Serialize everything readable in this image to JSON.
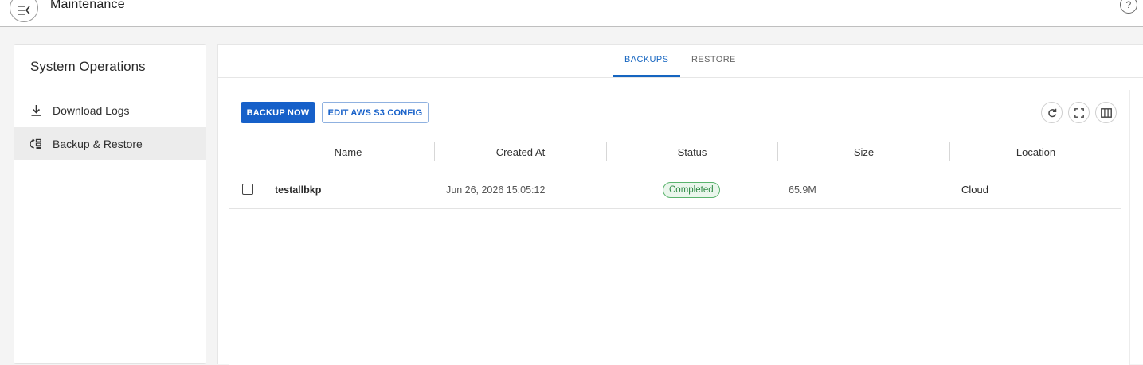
{
  "header": {
    "title": "Maintenance",
    "menu_icon": "menu-collapse-icon",
    "help_icon": "help-icon"
  },
  "sidebar": {
    "title": "System Operations",
    "items": [
      {
        "label": "Download Logs",
        "icon": "download-icon",
        "active": false
      },
      {
        "label": "Backup & Restore",
        "icon": "backup-restore-icon",
        "active": true
      }
    ]
  },
  "tabs": [
    {
      "label": "BACKUPS",
      "active": true
    },
    {
      "label": "RESTORE",
      "active": false
    }
  ],
  "toolbar": {
    "backup_now_label": "BACKUP NOW",
    "edit_s3_label": "EDIT AWS S3 CONFIG",
    "icons": [
      "refresh-icon",
      "fullscreen-icon",
      "columns-icon"
    ]
  },
  "table": {
    "columns": [
      "Name",
      "Created At",
      "Status",
      "Size",
      "Location"
    ],
    "rows": [
      {
        "name": "testallbkp",
        "created_at": "Jun 26, 2026 15:05:12",
        "status": "Completed",
        "size": "65.9M",
        "location": "Cloud"
      }
    ]
  },
  "colors": {
    "primary": "#1660c9",
    "status_completed": "#2f8a45"
  }
}
